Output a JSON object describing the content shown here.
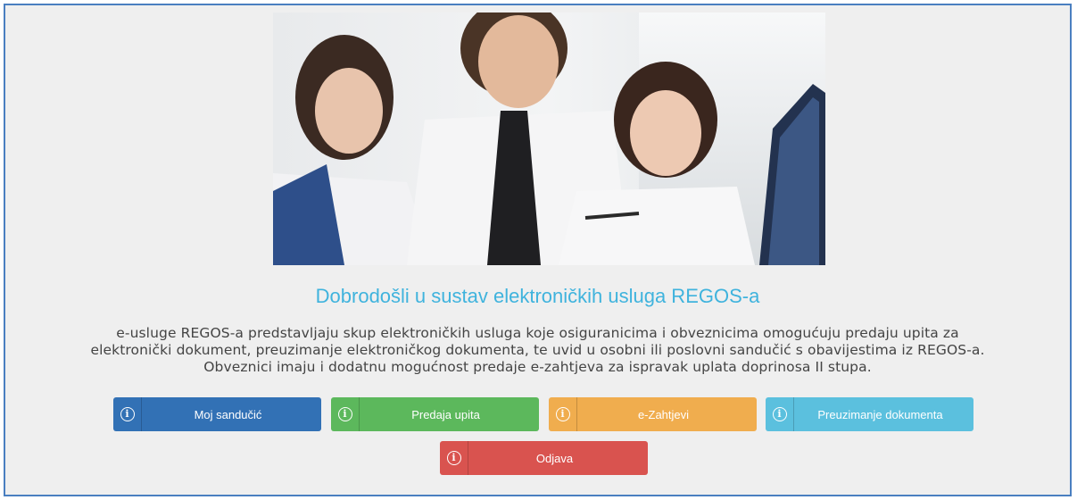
{
  "page": {
    "title": "Dobrodošli u sustav elektroničkih usluga REGOS-a",
    "description_lines": [
      "e-usluge REGOS-a predstavljaju skup elektroničkih usluga koje osiguranicima i obveznicima omogućuju predaju upita za",
      "elektronički dokument, preuzimanje elektroničkog dokumenta, te uvid u osobni ili poslovni sandučić s obavijestima iz REGOS-a.",
      "Obveznici imaju i dodatnu mogućnost predaje e-zahtjeva za ispravak uplata doprinosa II stupa."
    ],
    "hero_image": "office-team-photo"
  },
  "buttons": {
    "moj_sanducic": {
      "label": "Moj sandučić",
      "color": "#3271b5",
      "icon": "info-icon"
    },
    "predaja_upita": {
      "label": "Predaja upita",
      "color": "#5cb85c",
      "icon": "info-icon"
    },
    "e_zahtjevi": {
      "label": "e-Zahtjevi",
      "color": "#f0ad4e",
      "icon": "info-icon"
    },
    "preuzimanje": {
      "label": "Preuzimanje dokumenta",
      "color": "#5bc0de",
      "icon": "info-icon"
    },
    "odjava": {
      "label": "Odjava",
      "color": "#d9534f",
      "icon": "info-icon"
    }
  }
}
